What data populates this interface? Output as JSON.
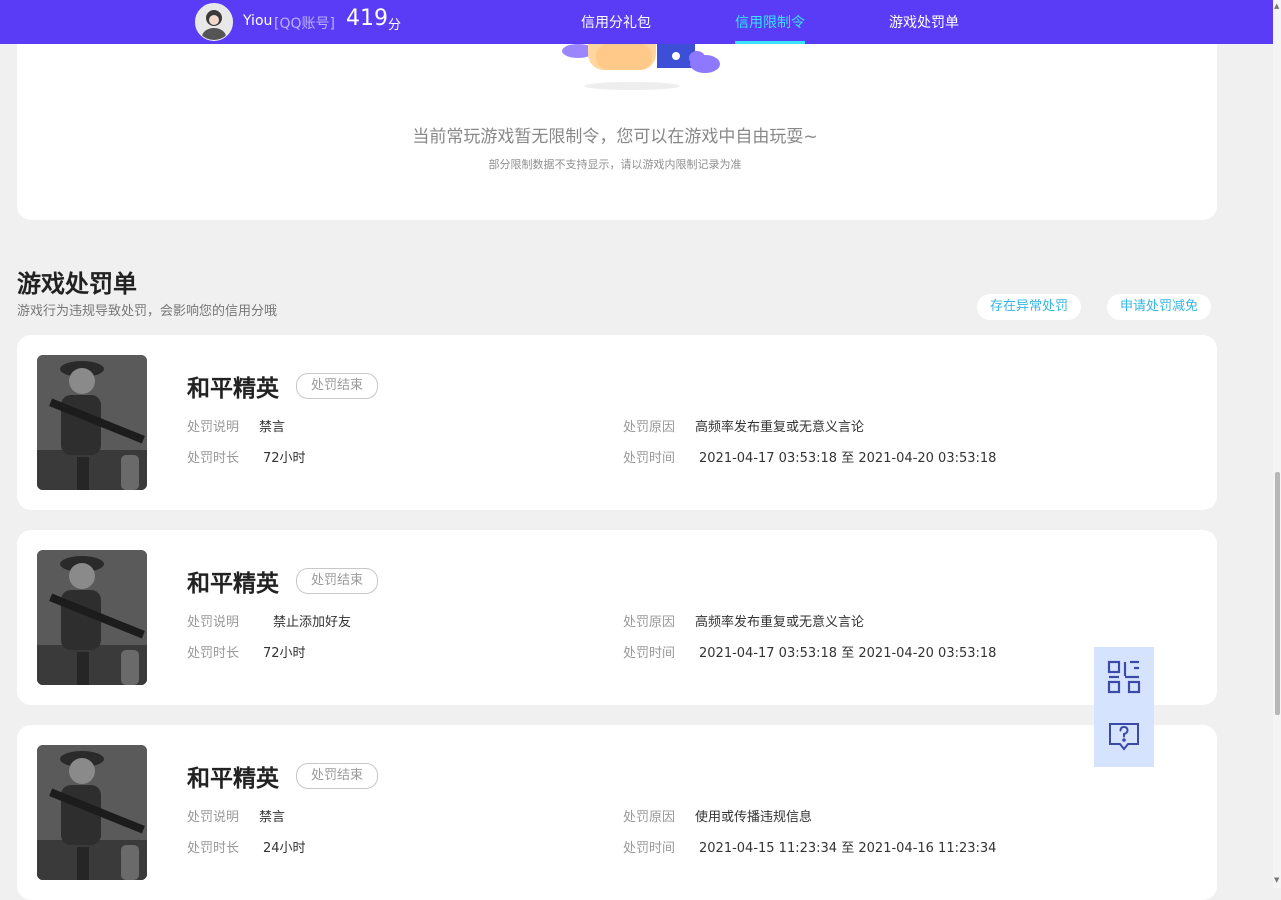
{
  "header": {
    "username": "Yiou",
    "account_type": "[QQ账号]",
    "score": "419",
    "score_unit": "分",
    "tabs": [
      {
        "label": "信用分礼包",
        "active": false
      },
      {
        "label": "信用限制令",
        "active": true
      },
      {
        "label": "游戏处罚单",
        "active": false
      }
    ],
    "brand_color": "#5a3cf6",
    "active_tab_color": "#37e3ff"
  },
  "restrictions": {
    "empty_message": "当前常玩游戏暂无限制令，您可以在游戏中自由玩耍~",
    "empty_note": "部分限制数据不支持显示，请以游戏内限制记录为准"
  },
  "penalties": {
    "title": "游戏处罚单",
    "description": "游戏行为违规导致处罚，会影响您的信用分哦",
    "actions": [
      "存在异常处罚",
      "申请处罚减免"
    ],
    "labels": {
      "desc": "处罚说明",
      "duration": "处罚时长",
      "reason": "处罚原因",
      "time": "处罚时间",
      "time_separator": "至"
    },
    "items": [
      {
        "game": "和平精英",
        "status": "处罚结束",
        "desc": "禁言",
        "duration": "72小时",
        "reason": "高频率发布重复或无意义言论",
        "start": "2021-04-17 03:53:18",
        "end": "2021-04-20 03:53:18"
      },
      {
        "game": "和平精英",
        "status": "处罚结束",
        "desc": "禁止添加好友",
        "duration": "72小时",
        "reason": "高频率发布重复或无意义言论",
        "start": "2021-04-17 03:53:18",
        "end": "2021-04-20 03:53:18"
      },
      {
        "game": "和平精英",
        "status": "处罚结束",
        "desc": "禁言",
        "duration": "24小时",
        "reason": "使用或传播违规信息",
        "start": "2021-04-15 11:23:34",
        "end": "2021-04-16 11:23:34"
      }
    ]
  },
  "floating": {
    "icons": [
      "qr-code-icon",
      "feedback-question-icon"
    ]
  }
}
